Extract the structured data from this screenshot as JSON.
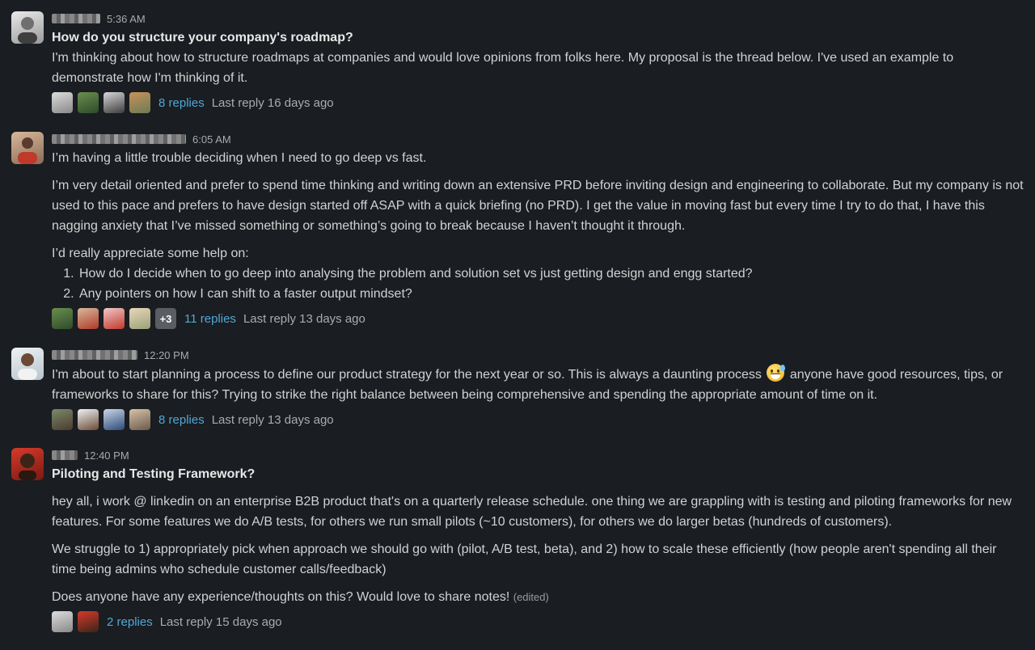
{
  "messages": [
    {
      "time": "5:36 AM",
      "title": "How do you structure your company's roadmap?",
      "body": "I'm thinking about how to structure roadmaps at companies and would love opinions from folks here. My proposal is the thread below. I've used an example to demonstrate how I'm thinking of it.",
      "replies": "8 replies",
      "last_reply": "Last reply 16 days ago"
    },
    {
      "time": "6:05 AM",
      "line1": "I’m having a little trouble deciding when I need to go deep vs fast.",
      "para1": "I’m very detail oriented and prefer to spend time thinking and writing down an extensive PRD before inviting design and engineering to collaborate. But my company is not used to this pace and prefers to have design started off ASAP with a quick briefing (no PRD). I get the value in moving fast but every time I try to do that, I have this nagging anxiety that I’ve missed something or something’s going to break because I haven’t thought it through.",
      "para2": "I’d really appreciate some help on:",
      "list": [
        "How do I decide when to go deep into analysing the problem and solution set vs just getting design and engg started?",
        "Any pointers on how I can shift to a faster output mindset?"
      ],
      "more_avatars": "+3",
      "replies": "11 replies",
      "last_reply": "Last reply 13 days ago"
    },
    {
      "time": "12:20 PM",
      "body_a": "I'm about to start planning a process to define our product strategy for the next year or so. This is always a daunting process",
      "emoji": "sweat-smile-emoji",
      "body_b": "anyone have good resources, tips, or frameworks to share for this? Trying to strike the right balance between being comprehensive and spending the appropriate amount of time on it.",
      "replies": "8 replies",
      "last_reply": "Last reply 13 days ago"
    },
    {
      "time": "12:40 PM",
      "title": "Piloting and Testing Framework?",
      "para1": "hey all, i work @ linkedin on an enterprise B2B product that's on a quarterly release schedule. one thing we are grappling with is testing and piloting frameworks for new features. For some features we do A/B tests, for others we run small pilots (~10 customers), for others we do larger betas (hundreds of customers).",
      "para2": "We struggle to 1) appropriately pick when approach we should go with (pilot, A/B test, beta), and 2) how to scale these efficiently (how people aren't spending all their time being admins who schedule customer calls/feedback)",
      "para3": "Does anyone have any experience/thoughts on this? Would love to share notes!",
      "edited": "(edited)",
      "replies": "2 replies",
      "last_reply": "Last reply 15 days ago"
    }
  ],
  "colors": {
    "background": "#1a1d21",
    "text": "#d1d2d3",
    "link": "#4fa8d8",
    "muted": "#ababad"
  }
}
